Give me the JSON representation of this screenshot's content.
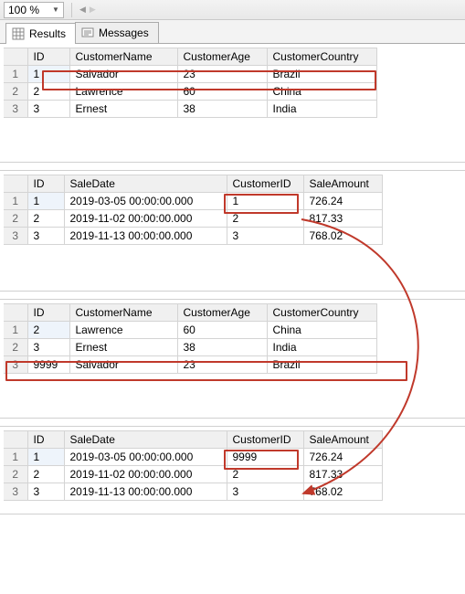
{
  "toolbar": {
    "zoom": "100 %"
  },
  "tabs": {
    "results_label": "Results",
    "messages_label": "Messages"
  },
  "cols": {
    "customers": {
      "id": "ID",
      "name": "CustomerName",
      "age": "CustomerAge",
      "country": "CustomerCountry"
    },
    "sales": {
      "id": "ID",
      "date": "SaleDate",
      "cid": "CustomerID",
      "amount": "SaleAmount"
    }
  },
  "table1": {
    "rows": [
      {
        "rn": "1",
        "id": "1",
        "name": "Salvador",
        "age": "23",
        "country": "Brazil"
      },
      {
        "rn": "2",
        "id": "2",
        "name": "Lawrence",
        "age": "60",
        "country": "China"
      },
      {
        "rn": "3",
        "id": "3",
        "name": "Ernest",
        "age": "38",
        "country": "India"
      }
    ]
  },
  "table2": {
    "rows": [
      {
        "rn": "1",
        "id": "1",
        "date": "2019-03-05 00:00:00.000",
        "cid": "1",
        "amount": "726.24"
      },
      {
        "rn": "2",
        "id": "2",
        "date": "2019-11-02 00:00:00.000",
        "cid": "2",
        "amount": "817.33"
      },
      {
        "rn": "3",
        "id": "3",
        "date": "2019-11-13 00:00:00.000",
        "cid": "3",
        "amount": "768.02"
      }
    ]
  },
  "table3": {
    "rows": [
      {
        "rn": "1",
        "id": "2",
        "name": "Lawrence",
        "age": "60",
        "country": "China"
      },
      {
        "rn": "2",
        "id": "3",
        "name": "Ernest",
        "age": "38",
        "country": "India"
      },
      {
        "rn": "3",
        "id": "9999",
        "name": "Salvador",
        "age": "23",
        "country": "Brazil"
      }
    ]
  },
  "table4": {
    "rows": [
      {
        "rn": "1",
        "id": "1",
        "date": "2019-03-05 00:00:00.000",
        "cid": "9999",
        "amount": "726.24"
      },
      {
        "rn": "2",
        "id": "2",
        "date": "2019-11-02 00:00:00.000",
        "cid": "2",
        "amount": "817.33"
      },
      {
        "rn": "3",
        "id": "3",
        "date": "2019-11-13 00:00:00.000",
        "cid": "3",
        "amount": "768.02"
      }
    ]
  },
  "highlight_color": "#c0392b"
}
